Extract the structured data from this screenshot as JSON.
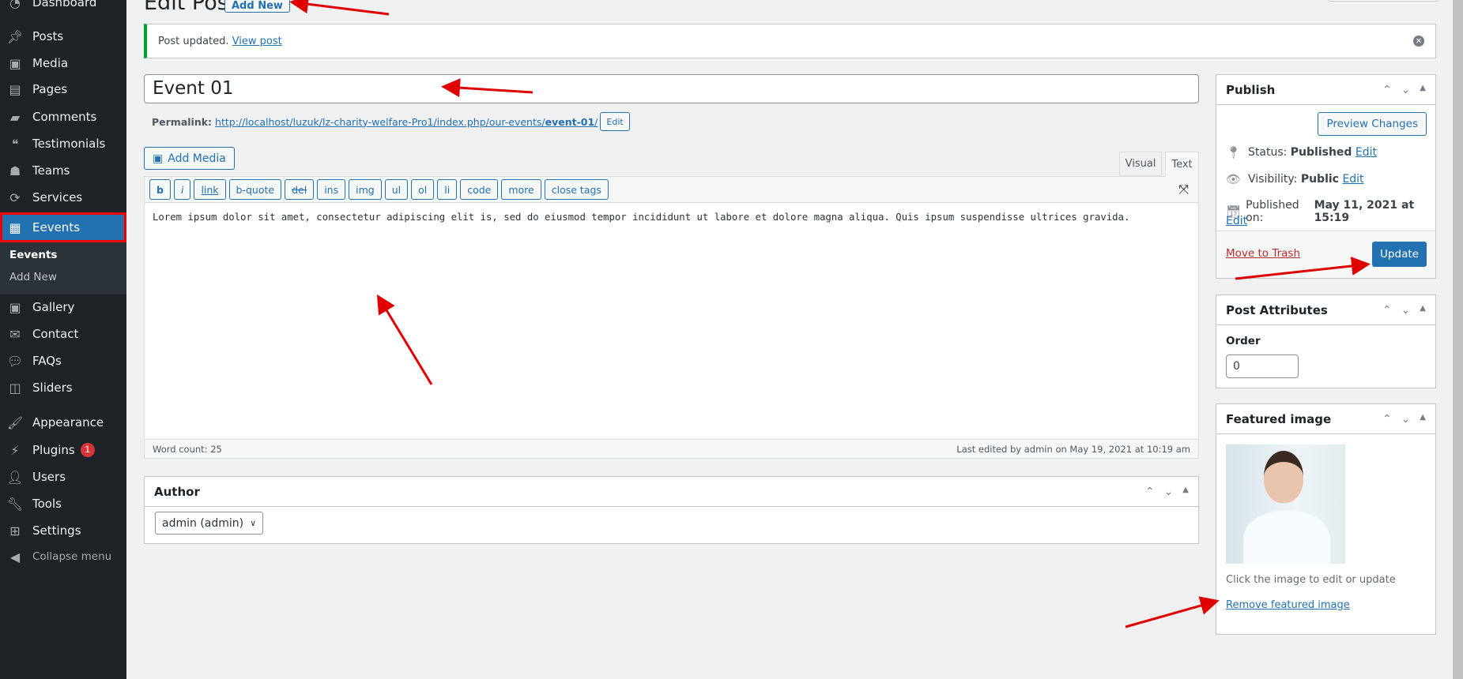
{
  "sidebar": {
    "items": [
      {
        "label": "Dashboard",
        "icon": "dashboard-icon"
      },
      {
        "label": "Posts",
        "icon": "pin-icon"
      },
      {
        "label": "Media",
        "icon": "media-icon"
      },
      {
        "label": "Pages",
        "icon": "pages-icon"
      },
      {
        "label": "Comments",
        "icon": "comment-icon"
      },
      {
        "label": "Testimonials",
        "icon": "testimonial-icon"
      },
      {
        "label": "Teams",
        "icon": "groups-icon"
      },
      {
        "label": "Services",
        "icon": "update-icon"
      },
      {
        "label": "Eevents",
        "icon": "grid-icon"
      },
      {
        "label": "Gallery",
        "icon": "media-icon"
      },
      {
        "label": "Contact",
        "icon": "email-icon"
      },
      {
        "label": "FAQs",
        "icon": "chat-icon"
      },
      {
        "label": "Sliders",
        "icon": "slides-icon"
      },
      {
        "label": "Appearance",
        "icon": "brush-icon"
      },
      {
        "label": "Plugins",
        "icon": "plugin-icon",
        "badge": "1"
      },
      {
        "label": "Users",
        "icon": "user-icon"
      },
      {
        "label": "Tools",
        "icon": "wrench-icon"
      },
      {
        "label": "Settings",
        "icon": "settings-icon"
      },
      {
        "label": "Collapse menu",
        "icon": "collapse-icon"
      }
    ],
    "submenu": [
      "Eevents",
      "Add New"
    ]
  },
  "header": {
    "title": "Edit Post",
    "add_new": "Add New"
  },
  "notice": {
    "text": "Post updated.",
    "link": "View post"
  },
  "post": {
    "title": "Event 01",
    "permalink_label": "Permalink:",
    "permalink_base": "http://localhost/luzuk/lz-charity-welfare-Pro1/index.php/our-events/",
    "permalink_slug": "event-01",
    "permalink_end": "/",
    "edit": "Edit"
  },
  "editor": {
    "add_media": "Add Media",
    "tabs": [
      "Visual",
      "Text"
    ],
    "active_tab": "Text",
    "buttons": [
      "b",
      "i",
      "link",
      "b-quote",
      "del",
      "ins",
      "img",
      "ul",
      "ol",
      "li",
      "code",
      "more",
      "close tags"
    ],
    "content": "Lorem ipsum dolor sit amet, consectetur adipiscing elit is, sed do eiusmod tempor incididunt ut labore et dolore magna aliqua. Quis ipsum suspendisse ultrices gravida.",
    "word_count": "Word count: 25",
    "last_edited": "Last edited by admin on May 19, 2021 at 10:19 am"
  },
  "author": {
    "title": "Author",
    "value": "admin (admin)"
  },
  "publish": {
    "title": "Publish",
    "preview": "Preview Changes",
    "status_label": "Status:",
    "status": "Published",
    "visibility_label": "Visibility:",
    "visibility": "Public",
    "published_label": "Published on:",
    "published": "May 11, 2021 at 15:19",
    "edit": "Edit",
    "trash": "Move to Trash",
    "update": "Update"
  },
  "attributes": {
    "title": "Post Attributes",
    "order_label": "Order",
    "order": "0"
  },
  "featured": {
    "title": "Featured image",
    "hint": "Click the image to edit or update",
    "remove": "Remove featured image"
  },
  "colors": {
    "accent": "#2271b1",
    "annotation": "#e00000",
    "sidebar": "#1d2327"
  }
}
